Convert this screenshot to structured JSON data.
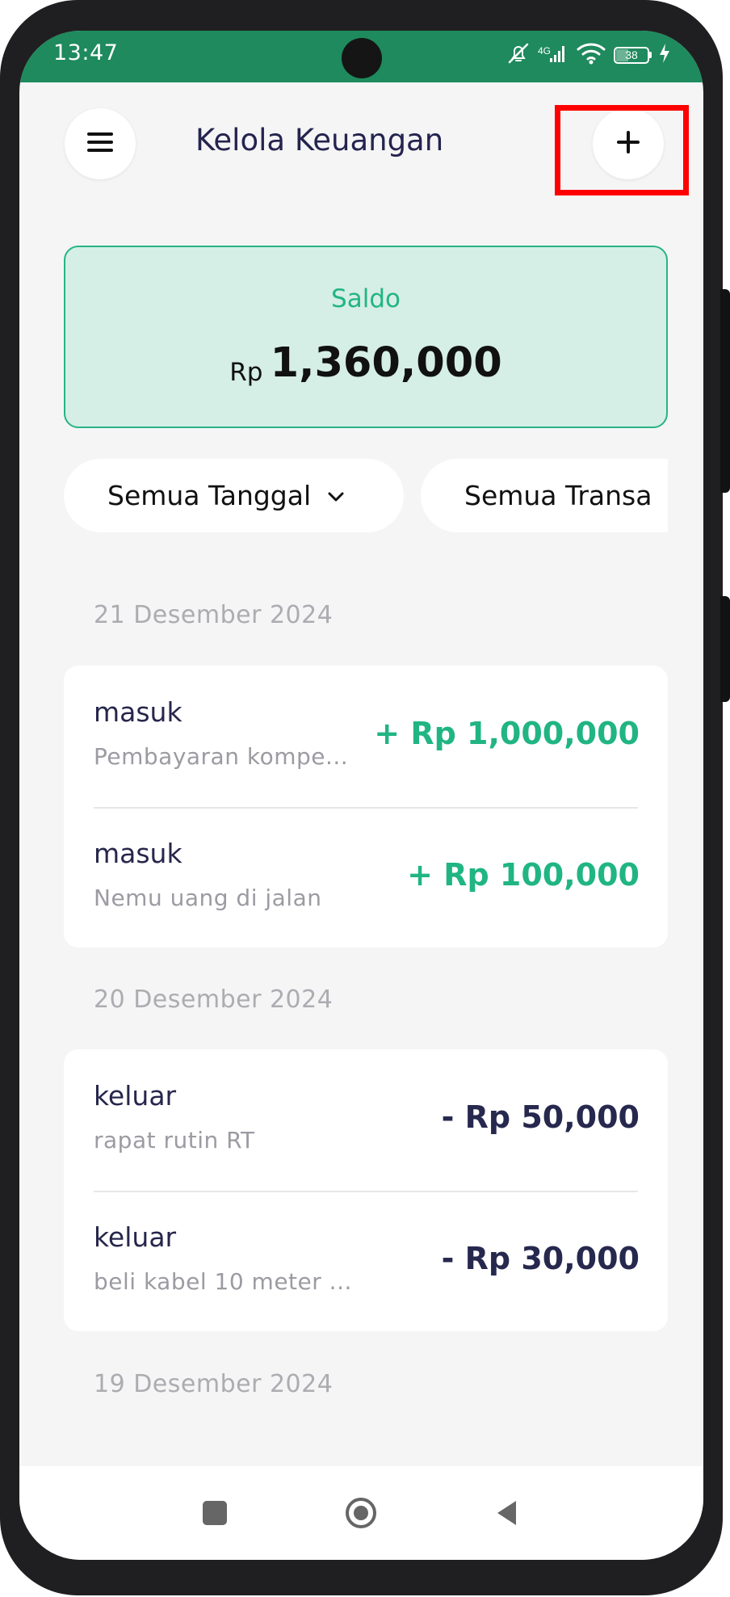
{
  "status_bar": {
    "time": "13:47",
    "battery": "38",
    "battery_level": 0.38,
    "icons": [
      "muted-bell-icon",
      "signal-icon",
      "wifi-icon",
      "battery-icon",
      "charging-icon"
    ]
  },
  "header": {
    "title": "Kelola Keuangan",
    "menu_icon": "hamburger-menu-icon",
    "add_icon": "plus-icon"
  },
  "balance": {
    "label": "Saldo",
    "currency": "Rp",
    "amount": "1,360,000"
  },
  "filters": {
    "date_label": "Semua Tanggal",
    "type_label": "Semua Transa"
  },
  "transactions": [
    {
      "date": "21 Desember 2024",
      "items": [
        {
          "type": "masuk",
          "description": "Pembayaran kompe...",
          "amount": "+ Rp 1,000,000",
          "direction": "income"
        },
        {
          "type": "masuk",
          "description": "Nemu uang di jalan",
          "amount": "+ Rp 100,000",
          "direction": "income"
        }
      ]
    },
    {
      "date": "20 Desember 2024",
      "items": [
        {
          "type": "keluar",
          "description": "rapat rutin RT",
          "amount": "- Rp 50,000",
          "direction": "expense"
        },
        {
          "type": "keluar",
          "description": "beli kabel 10 meter ...",
          "amount": "- Rp 30,000",
          "direction": "expense"
        }
      ]
    },
    {
      "date": "19 Desember 2024",
      "items": []
    }
  ],
  "colors": {
    "brand": "#1e8a5d",
    "balance_card_bg": "#d5eee6",
    "balance_card_border": "#27b485",
    "income": "#20b583",
    "expense": "#27284e",
    "highlight": "#ff0000"
  },
  "navigation": {
    "icons": [
      "recent-apps-icon",
      "home-icon",
      "back-icon"
    ]
  }
}
